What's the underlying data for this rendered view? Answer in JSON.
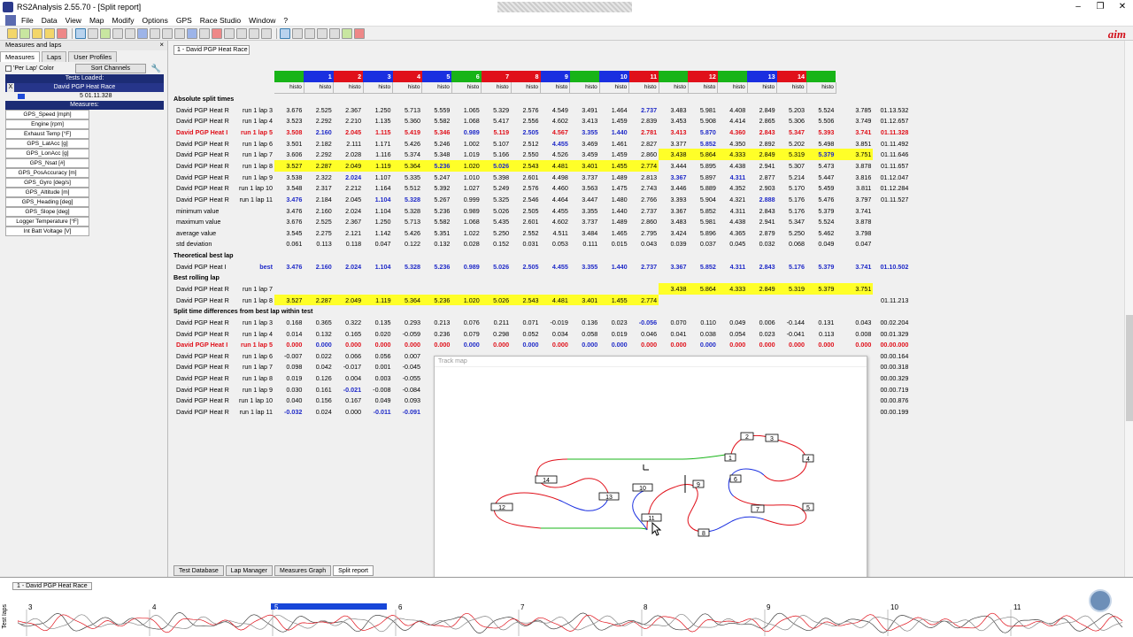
{
  "window": {
    "title": "RS2Analysis 2.55.70 - [Split report]"
  },
  "menu": [
    "File",
    "Data",
    "View",
    "Map",
    "Modify",
    "Options",
    "GPS",
    "Race Studio",
    "Window",
    "?"
  ],
  "logo": "aim",
  "left_panel": {
    "title": "Measures and laps",
    "close": "×",
    "tabs": [
      "Measures",
      "Laps",
      "User Profiles"
    ],
    "per_lap_color": "'Per Lap' Color",
    "sort_channels": "Sort Channels",
    "tests_loaded_label": "Tests Loaded:",
    "test_name": "David PGP Heat Race",
    "test_close": "X",
    "test_time": "5 01.11.328",
    "measures_label": "Measures:",
    "measures": [
      "GPS_Speed     [mph]",
      "Engine     [rpm]",
      "Exhaust Temp     [°F]",
      "GPS_LatAcc     [g]",
      "GPS_LonAcc     [g]",
      "GPS_Nsat     [#]",
      "GPS_PosAccuracy     [m]",
      "GPS_Gyro     [deg/s]",
      "GPS_Altitude     [m]",
      "GPS_Heading     [deg]",
      "GPS_Slope     [deg]",
      "Logger Temperature     [°F]",
      "Int Batt Voltage     [V]"
    ]
  },
  "doc_tab": "1 - David PGP Heat Race",
  "colors": {
    "green": "#18b418",
    "blue": "#1a2fe0",
    "red": "#e0101a",
    "highlight": "#ffff28",
    "navy": "#1c2c75"
  },
  "segments": [
    {
      "num": "",
      "color": "green"
    },
    {
      "num": "1",
      "color": "blue"
    },
    {
      "num": "2",
      "color": "red"
    },
    {
      "num": "3",
      "color": "blue"
    },
    {
      "num": "4",
      "color": "red"
    },
    {
      "num": "5",
      "color": "blue"
    },
    {
      "num": "6",
      "color": "green"
    },
    {
      "num": "7",
      "color": "red"
    },
    {
      "num": "8",
      "color": "red"
    },
    {
      "num": "9",
      "color": "blue"
    },
    {
      "num": "",
      "color": "green"
    },
    {
      "num": "10",
      "color": "blue"
    },
    {
      "num": "11",
      "color": "red"
    },
    {
      "num": "",
      "color": "green"
    },
    {
      "num": "12",
      "color": "red"
    },
    {
      "num": "",
      "color": "green"
    },
    {
      "num": "13",
      "color": "blue"
    },
    {
      "num": "14",
      "color": "red"
    },
    {
      "num": "",
      "color": "green"
    }
  ],
  "histo_label": "histo",
  "sections": {
    "absolute": "Absolute split times",
    "theoretical": "Theoretical best lap",
    "rolling": "Best rolling lap",
    "differences": "Split time differences from best lap within test"
  },
  "absolute_rows": [
    {
      "name": "David PGP Heat R",
      "lap": "run 1 lap 3",
      "values": [
        "3.676",
        "2.525",
        "2.367",
        "1.250",
        "5.713",
        "5.559",
        "1.065",
        "5.329",
        "2.576",
        "4.549",
        "3.491",
        "1.464",
        "2.737",
        "3.483",
        "5.981",
        "4.408",
        "2.849",
        "5.203",
        "5.524",
        "3.785"
      ],
      "total": "01.13.532",
      "bold": [
        12
      ]
    },
    {
      "name": "David PGP Heat R",
      "lap": "run 1 lap 4",
      "values": [
        "3.523",
        "2.292",
        "2.210",
        "1.135",
        "5.360",
        "5.582",
        "1.068",
        "5.417",
        "2.556",
        "4.602",
        "3.413",
        "1.459",
        "2.839",
        "3.453",
        "5.908",
        "4.414",
        "2.865",
        "5.306",
        "5.506",
        "3.749"
      ],
      "total": "01.12.657"
    },
    {
      "name": "David PGP Heat I",
      "lap": "run 1 lap 5",
      "values": [
        "3.508",
        "2.160",
        "2.045",
        "1.115",
        "5.419",
        "5.346",
        "0.989",
        "5.119",
        "2.505",
        "4.567",
        "3.355",
        "1.440",
        "2.781",
        "3.413",
        "5.870",
        "4.360",
        "2.843",
        "5.347",
        "5.393",
        "3.741"
      ],
      "total": "01.11.328",
      "red": true,
      "bold": [
        1,
        6,
        8,
        10,
        11,
        14,
        18,
        19
      ]
    },
    {
      "name": "David PGP Heat R",
      "lap": "run 1 lap 6",
      "values": [
        "3.501",
        "2.182",
        "2.111",
        "1.171",
        "5.426",
        "5.246",
        "1.002",
        "5.107",
        "2.512",
        "4.455",
        "3.469",
        "1.461",
        "2.827",
        "3.377",
        "5.852",
        "4.350",
        "2.892",
        "5.202",
        "5.498",
        "3.851"
      ],
      "total": "01.11.492",
      "bold": [
        9,
        14
      ]
    },
    {
      "name": "David PGP Heat R",
      "lap": "run 1 lap 7",
      "values": [
        "3.606",
        "2.292",
        "2.028",
        "1.116",
        "5.374",
        "5.348",
        "1.019",
        "5.166",
        "2.550",
        "4.526",
        "3.459",
        "1.459",
        "2.860",
        "3.438",
        "5.864",
        "4.333",
        "2.849",
        "5.319",
        "5.379",
        "3.751"
      ],
      "total": "01.11.646",
      "hl": [
        13,
        14,
        15,
        16,
        17,
        18,
        19
      ],
      "bold": [
        18
      ]
    },
    {
      "name": "David PGP Heat R",
      "lap": "run 1 lap 8",
      "values": [
        "3.527",
        "2.287",
        "2.049",
        "1.119",
        "5.364",
        "5.236",
        "1.020",
        "5.026",
        "2.543",
        "4.481",
        "3.401",
        "1.455",
        "2.774",
        "3.444",
        "5.895",
        "4.438",
        "2.941",
        "5.307",
        "5.473",
        "3.878"
      ],
      "total": "01.11.657",
      "hl": [
        0,
        1,
        2,
        3,
        4,
        5,
        6,
        7,
        8,
        9,
        10,
        11,
        12
      ],
      "bold": [
        5,
        7
      ]
    },
    {
      "name": "David PGP Heat R",
      "lap": "run 1 lap 9",
      "values": [
        "3.538",
        "2.322",
        "2.024",
        "1.107",
        "5.335",
        "5.247",
        "1.010",
        "5.398",
        "2.601",
        "4.498",
        "3.737",
        "1.489",
        "2.813",
        "3.367",
        "5.897",
        "4.311",
        "2.877",
        "5.214",
        "5.447",
        "3.816"
      ],
      "total": "01.12.047",
      "bold": [
        2,
        13,
        15
      ]
    },
    {
      "name": "David PGP Heat R",
      "lap": "run 1 lap 10",
      "values": [
        "3.548",
        "2.317",
        "2.212",
        "1.164",
        "5.512",
        "5.392",
        "1.027",
        "5.249",
        "2.576",
        "4.460",
        "3.563",
        "1.475",
        "2.743",
        "3.446",
        "5.889",
        "4.352",
        "2.903",
        "5.170",
        "5.459",
        "3.811"
      ],
      "total": "01.12.284"
    },
    {
      "name": "David PGP Heat R",
      "lap": "run 1 lap 11",
      "values": [
        "3.476",
        "2.184",
        "2.045",
        "1.104",
        "5.328",
        "5.267",
        "0.999",
        "5.325",
        "2.546",
        "4.464",
        "3.447",
        "1.480",
        "2.766",
        "3.393",
        "5.904",
        "4.321",
        "2.888",
        "5.176",
        "5.476",
        "3.797"
      ],
      "total": "01.11.527",
      "bold": [
        0,
        3,
        4,
        16
      ]
    }
  ],
  "stat_rows": [
    {
      "name": "minimum value",
      "values": [
        "3.476",
        "2.160",
        "2.024",
        "1.104",
        "5.328",
        "5.236",
        "0.989",
        "5.026",
        "2.505",
        "4.455",
        "3.355",
        "1.440",
        "2.737",
        "3.367",
        "5.852",
        "4.311",
        "2.843",
        "5.176",
        "5.379",
        "3.741"
      ]
    },
    {
      "name": "maximum value",
      "values": [
        "3.676",
        "2.525",
        "2.367",
        "1.250",
        "5.713",
        "5.582",
        "1.068",
        "5.435",
        "2.601",
        "4.602",
        "3.737",
        "1.489",
        "2.860",
        "3.483",
        "5.981",
        "4.438",
        "2.941",
        "5.347",
        "5.524",
        "3.878"
      ]
    },
    {
      "name": "average value",
      "values": [
        "3.545",
        "2.275",
        "2.121",
        "1.142",
        "5.426",
        "5.351",
        "1.022",
        "5.250",
        "2.552",
        "4.511",
        "3.484",
        "1.465",
        "2.795",
        "3.424",
        "5.896",
        "4.365",
        "2.879",
        "5.250",
        "5.462",
        "3.798"
      ]
    },
    {
      "name": "std deviation",
      "values": [
        "0.061",
        "0.113",
        "0.118",
        "0.047",
        "0.122",
        "0.132",
        "0.028",
        "0.152",
        "0.031",
        "0.053",
        "0.111",
        "0.015",
        "0.043",
        "0.039",
        "0.037",
        "0.045",
        "0.032",
        "0.068",
        "0.049",
        "0.047"
      ]
    }
  ],
  "theoretical_row": {
    "name": "David PGP Heat I",
    "lap": "best",
    "values": [
      "3.476",
      "2.160",
      "2.024",
      "1.104",
      "5.328",
      "5.236",
      "0.989",
      "5.026",
      "2.505",
      "4.455",
      "3.355",
      "1.440",
      "2.737",
      "3.367",
      "5.852",
      "4.311",
      "2.843",
      "5.176",
      "5.379",
      "3.741"
    ],
    "total": "01.10.502"
  },
  "rolling_rows": [
    {
      "name": "David PGP Heat R",
      "lap": "run 1 lap 7",
      "values": [
        "",
        "",
        "",
        "",
        "",
        "",
        "",
        "",
        "",
        "",
        "",
        "",
        "",
        "3.438",
        "5.864",
        "4.333",
        "2.849",
        "5.319",
        "5.379",
        "3.751"
      ],
      "total": "",
      "hl": [
        13,
        14,
        15,
        16,
        17,
        18,
        19
      ]
    },
    {
      "name": "David PGP Heat R",
      "lap": "run 1 lap 8",
      "values": [
        "3.527",
        "2.287",
        "2.049",
        "1.119",
        "5.364",
        "5.236",
        "1.020",
        "5.026",
        "2.543",
        "4.481",
        "3.401",
        "1.455",
        "2.774",
        "",
        "",
        "",
        "",
        "",
        "",
        ""
      ],
      "total": "01.11.213",
      "hl": [
        0,
        1,
        2,
        3,
        4,
        5,
        6,
        7,
        8,
        9,
        10,
        11,
        12
      ]
    }
  ],
  "diff_rows": [
    {
      "name": "David PGP Heat R",
      "lap": "run 1 lap 3",
      "values": [
        "0.168",
        "0.365",
        "0.322",
        "0.135",
        "0.293",
        "0.213",
        "0.076",
        "0.211",
        "0.071",
        "-0.019",
        "0.136",
        "0.023",
        "-0.056",
        "0.070",
        "0.110",
        "0.049",
        "0.006",
        "-0.144",
        "0.131",
        "0.043"
      ],
      "total": "00.02.204",
      "bold": [
        12
      ]
    },
    {
      "name": "David PGP Heat R",
      "lap": "run 1 lap 4",
      "values": [
        "0.014",
        "0.132",
        "0.165",
        "0.020",
        "-0.059",
        "0.236",
        "0.079",
        "0.298",
        "0.052",
        "0.034",
        "0.058",
        "0.019",
        "0.046",
        "0.041",
        "0.038",
        "0.054",
        "0.023",
        "-0.041",
        "0.113",
        "0.008"
      ],
      "total": "00.01.329"
    },
    {
      "name": "David PGP Heat I",
      "lap": "run 1 lap 5",
      "values": [
        "0.000",
        "0.000",
        "0.000",
        "0.000",
        "0.000",
        "0.000",
        "0.000",
        "0.000",
        "0.000",
        "0.000",
        "0.000",
        "0.000",
        "0.000",
        "0.000",
        "0.000",
        "0.000",
        "0.000",
        "0.000",
        "0.000",
        "0.000"
      ],
      "total": "00.00.000",
      "red": true,
      "bold": [
        1,
        6,
        8,
        10,
        11,
        14,
        18,
        19
      ]
    },
    {
      "name": "David PGP Heat R",
      "lap": "run 1 lap 6",
      "values": [
        "-0.007",
        "0.022",
        "0.066",
        "0.056",
        "0.007",
        "",
        "",
        "",
        "",
        "",
        "",
        "",
        "",
        "",
        "",
        "",
        "",
        "",
        "",
        ""
      ],
      "total": "00.00.164"
    },
    {
      "name": "David PGP Heat R",
      "lap": "run 1 lap 7",
      "values": [
        "0.098",
        "0.042",
        "-0.017",
        "0.001",
        "-0.045",
        "",
        "",
        "",
        "",
        "",
        "",
        "",
        "",
        "",
        "",
        "",
        "",
        "",
        "",
        ""
      ],
      "total": "00.00.318"
    },
    {
      "name": "David PGP Heat R",
      "lap": "run 1 lap 8",
      "values": [
        "0.019",
        "0.126",
        "0.004",
        "0.003",
        "-0.055",
        "",
        "",
        "",
        "",
        "",
        "",
        "",
        "",
        "",
        "",
        "",
        "",
        "",
        "",
        ""
      ],
      "total": "00.00.329"
    },
    {
      "name": "David PGP Heat R",
      "lap": "run 1 lap 9",
      "values": [
        "0.030",
        "0.161",
        "-0.021",
        "-0.008",
        "-0.084",
        "",
        "",
        "",
        "",
        "",
        "",
        "",
        "",
        "",
        "",
        "",
        "",
        "",
        "",
        ""
      ],
      "total": "00.00.719",
      "bold": [
        2
      ]
    },
    {
      "name": "David PGP Heat R",
      "lap": "run 1 lap 10",
      "values": [
        "0.040",
        "0.156",
        "0.167",
        "0.049",
        "0.093",
        "",
        "",
        "",
        "",
        "",
        "",
        "",
        "",
        "",
        "",
        "",
        "",
        "",
        "",
        ""
      ],
      "total": "00.00.876"
    },
    {
      "name": "David PGP Heat R",
      "lap": "run 1 lap 11",
      "values": [
        "-0.032",
        "0.024",
        "0.000",
        "-0.011",
        "-0.091",
        "",
        "",
        "",
        "",
        "",
        "",
        "",
        "",
        "",
        "",
        "",
        "",
        "",
        "",
        ""
      ],
      "total": "00.00.199",
      "bold": [
        0,
        3,
        4
      ]
    }
  ],
  "track_map": {
    "title": "Track map",
    "labels": [
      "1",
      "2",
      "3",
      "4",
      "5",
      "6",
      "7",
      "8",
      "9",
      "10",
      "11",
      "12",
      "13",
      "14"
    ]
  },
  "bottom_tabs": [
    "Test Database",
    "Lap Manager",
    "Measures Graph",
    "Split report"
  ],
  "bottom_strip": {
    "test_label": "1 - David PGP Heat Race",
    "vertical_label": "Test laps",
    "laps": [
      "3",
      "4",
      "5",
      "6",
      "7",
      "8",
      "9",
      "10",
      "11"
    ]
  }
}
